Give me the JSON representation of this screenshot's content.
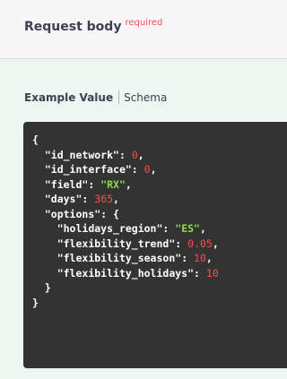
{
  "header": {
    "title": "Request body",
    "required_label": "required"
  },
  "tabs": {
    "example_value": "Example Value",
    "schema": "Schema"
  },
  "example_json": {
    "open_brace": "{",
    "close_brace": "}",
    "fields": [
      {
        "key": "\"id_network\"",
        "value": "0"
      },
      {
        "key": "\"id_interface\"",
        "value": "0"
      },
      {
        "key": "\"field\"",
        "value": "\"RX\""
      },
      {
        "key": "\"days\"",
        "value": "365"
      }
    ],
    "options": {
      "key": "\"options\"",
      "open_brace": "{",
      "close_brace": "}",
      "fields": [
        {
          "key": "\"holidays_region\"",
          "value": "\"ES\""
        },
        {
          "key": "\"flexibility_trend\"",
          "value": "0.05"
        },
        {
          "key": "\"flexibility_season\"",
          "value": "10"
        },
        {
          "key": "\"flexibility_holidays\"",
          "value": "10"
        }
      ]
    }
  },
  "colors": {
    "header_bg": "#f7f7f7",
    "body_bg": "#eef6f2",
    "code_bg": "#333333",
    "number": "#ff4b4b",
    "string": "#8fd94c",
    "required": "#ff4b4b"
  }
}
